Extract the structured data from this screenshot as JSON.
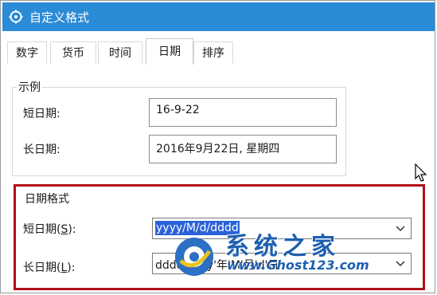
{
  "window": {
    "title": "自定义格式",
    "accent_color": "#2a8bd6",
    "icon": "gear-clock-icon"
  },
  "tabs": [
    {
      "label": "数字",
      "active": false
    },
    {
      "label": "货币",
      "active": false
    },
    {
      "label": "时间",
      "active": false
    },
    {
      "label": "日期",
      "active": true
    },
    {
      "label": "排序",
      "active": false
    }
  ],
  "example": {
    "title": "示例",
    "short_label": "短日期:",
    "short_value": "16-9-22",
    "long_label": "长日期:",
    "long_value": "2016年9月22日, 星期四"
  },
  "format": {
    "title": "日期格式",
    "highlight_color": "#b0101a",
    "short_label_prefix": "短日期(",
    "short_label_key": "S",
    "short_label_suffix": "):",
    "short_value": "yyyy/M/d/dddd",
    "long_label_prefix": "长日期(",
    "long_label_key": "L",
    "long_label_suffix": "):",
    "long_value": "dddd,yyyy'年'M'月'd'日'"
  },
  "watermark": {
    "title": "系统之家",
    "url": "www.Ghost123.com"
  }
}
